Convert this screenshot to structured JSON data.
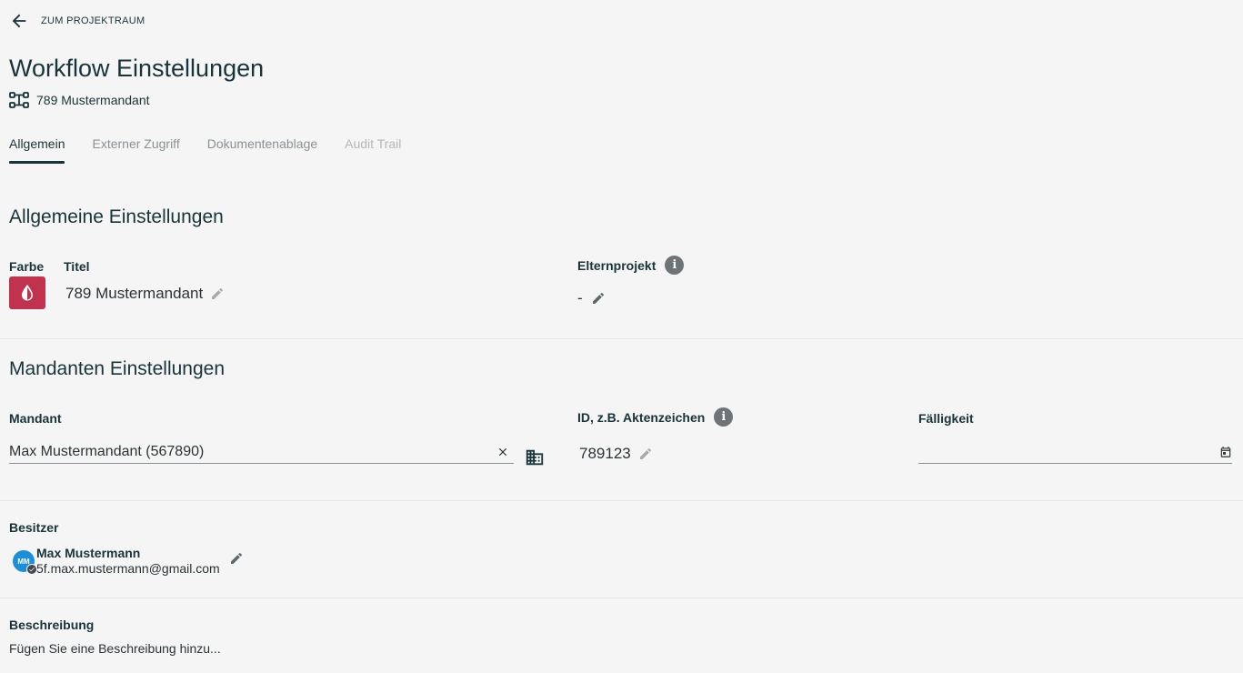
{
  "header": {
    "back_label": "ZUM PROJEKTRAUM",
    "title": "Workflow Einstellungen",
    "subtitle": "789 Mustermandant"
  },
  "tabs": [
    {
      "label": "Allgemein",
      "state": "active"
    },
    {
      "label": "Externer Zugriff",
      "state": "normal"
    },
    {
      "label": "Dokumentenablage",
      "state": "normal"
    },
    {
      "label": "Audit Trail",
      "state": "disabled"
    }
  ],
  "general": {
    "section_title": "Allgemeine Einstellungen",
    "color_label": "Farbe",
    "color_value": "#c0324e",
    "title_label": "Titel",
    "title_value": "789 Mustermandant",
    "parent_label": "Elternprojekt",
    "parent_value": "-"
  },
  "client": {
    "section_title": "Mandanten Einstellungen",
    "client_label": "Mandant",
    "client_value": "Max Mustermandant (567890)",
    "id_label": "ID, z.B. Aktenzeichen",
    "id_value": "789123",
    "due_label": "Fälligkeit",
    "due_value": ""
  },
  "owner": {
    "label": "Besitzer",
    "initials": "MM",
    "name": "Max Mustermann",
    "email": "5f.max.mustermann@gmail.com"
  },
  "description": {
    "label": "Beschreibung",
    "placeholder": "Fügen Sie eine Beschreibung hinzu..."
  },
  "icons": {
    "back": "arrow-left-icon",
    "workflow": "workflow-icon",
    "color": "drop-icon",
    "edit": "pencil-icon",
    "info": "info-icon",
    "clear": "close-icon",
    "client_picker": "building-icon",
    "calendar": "calendar-icon",
    "verified": "check-icon"
  },
  "colors": {
    "primary_text": "#17343a",
    "tab_inactive": "#8a9296",
    "tab_disabled": "#b3b8bb",
    "avatar": "#1d8fd8",
    "swatch": "#c0324e"
  }
}
